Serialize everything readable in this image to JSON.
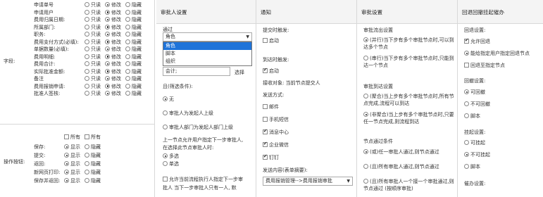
{
  "left": {
    "fields_label": "字段:",
    "ops_label": "操作按钮:",
    "opt_labels": {
      "readonly": "只读",
      "edit": "修改",
      "hidden": "隐藏",
      "show": "显示",
      "all": "所有"
    },
    "fields": [
      {
        "name": "申请单号",
        "sel": "edit"
      },
      {
        "name": "申请用户",
        "sel": "edit"
      },
      {
        "name": "费用归属日期:",
        "sel": "edit"
      },
      {
        "name": "所属部门:",
        "sel": "edit"
      },
      {
        "name": "职务:",
        "sel": "edit"
      },
      {
        "name": "费用支付方式(必填):",
        "sel": "edit"
      },
      {
        "name": "单据数量(必填):",
        "sel": "edit"
      },
      {
        "name": "费用明细:",
        "sel": "edit"
      },
      {
        "name": "费用合计:",
        "sel": "edit"
      },
      {
        "name": "实际批准金额:",
        "sel": "edit"
      },
      {
        "name": "备注",
        "sel": "edit"
      },
      {
        "name": "费用报销申请:",
        "sel": "edit"
      },
      {
        "name": "批准人签核:",
        "sel": "edit"
      }
    ],
    "ops": [
      {
        "name": "保存:",
        "sel": "show"
      },
      {
        "name": "提交:",
        "sel": "show"
      },
      {
        "name": "返回:",
        "sel": "show"
      },
      {
        "name": "新网页打印:",
        "sel": "show"
      },
      {
        "name": "保存并返回:",
        "sel": "show"
      }
    ]
  },
  "approver": {
    "title": "审批人设置",
    "via_label": "通过",
    "select_value": "角色",
    "dropdown": [
      "角色",
      "脚本",
      "组织"
    ],
    "dropdown_selected": 0,
    "accounting_label": "会计;",
    "choose_btn": "选择",
    "cond_label": "且(筛选条件):",
    "cond_opts": [
      "无",
      "审批人为发起人上级",
      "审批人部门为发起人部门上级"
    ],
    "cond_selected": 0,
    "multi_text1": "上一节点允许用户指定下一步审批人,",
    "multi_text2": "在选择此节点审批人时:",
    "multi_opts": [
      "多选",
      "单选"
    ],
    "multi_selected": 0,
    "allow_text1": "允许当前流程执行人指定下一步审",
    "allow_text2": "批人 当下一步审批人只有一人, 默"
  },
  "notify": {
    "title": "通知",
    "submit_label": "提交时触发:",
    "submit_enable": "启动",
    "submit_checked": false,
    "arrive_label": "到达时触发:",
    "arrive_enable": "启动",
    "arrive_checked": true,
    "receiver": "接收对象: 当前节点提交人",
    "method_label": "发送方式:",
    "methods": [
      {
        "label": "邮件",
        "checked": false
      },
      {
        "label": "手机短信",
        "checked": false
      },
      {
        "label": "消息中心",
        "checked": true
      },
      {
        "label": "企业微信",
        "checked": true
      },
      {
        "label": "钉钉",
        "checked": true
      }
    ],
    "content_label": "发送内容(表单摘要):",
    "content_value": "费用报销管理-->费用报销审批"
  },
  "approval": {
    "title": "审批设置",
    "parallel_label": "审批流出设置",
    "parallel_opts": [
      "(并行)当下步有多个审批节点时,可以到达多个节点",
      "(串行)当下步有多个审批节点时,只能到达一个节点"
    ],
    "parallel_selected": 0,
    "arrive_label": "审批到达设置",
    "arrive_opts": [
      "(聚合)当上步有多个审批节点时,所有节点完成,流程可以到达",
      "(非聚合)当上步有多个审批节点时,只要任一节点完成,则流程到达"
    ],
    "arrive_selected": 1,
    "pass_label": "节点通过条件",
    "pass_opts": [
      "(或)任一审批人通过,则节点通过",
      "(且)所有审批人通过,则节点通过",
      "(且)所有审批人一个接一个审批通过,则节点通过 (按顺序审批)"
    ],
    "pass_selected": 0
  },
  "rollback": {
    "title": "回退回撤挂起催办",
    "back_label": "回退设置:",
    "back_opts": [
      {
        "label": "允许回退",
        "checked": true,
        "kind": "chk"
      },
      {
        "label": "能给指定用户指定回退节点",
        "checked": true,
        "kind": "radio"
      },
      {
        "label": "回退至指定节点",
        "checked": false,
        "kind": "chk"
      }
    ],
    "revoke_label": "回撤设置:",
    "revoke_opts": [
      "可回撤",
      "不可回撤",
      "脚本"
    ],
    "revoke_selected": 0,
    "hang_label": "挂起设置:",
    "hang_opts": [
      "可挂起",
      "不可挂起",
      "脚本"
    ],
    "hang_selected": 1,
    "urge_label": "催办设置:"
  }
}
